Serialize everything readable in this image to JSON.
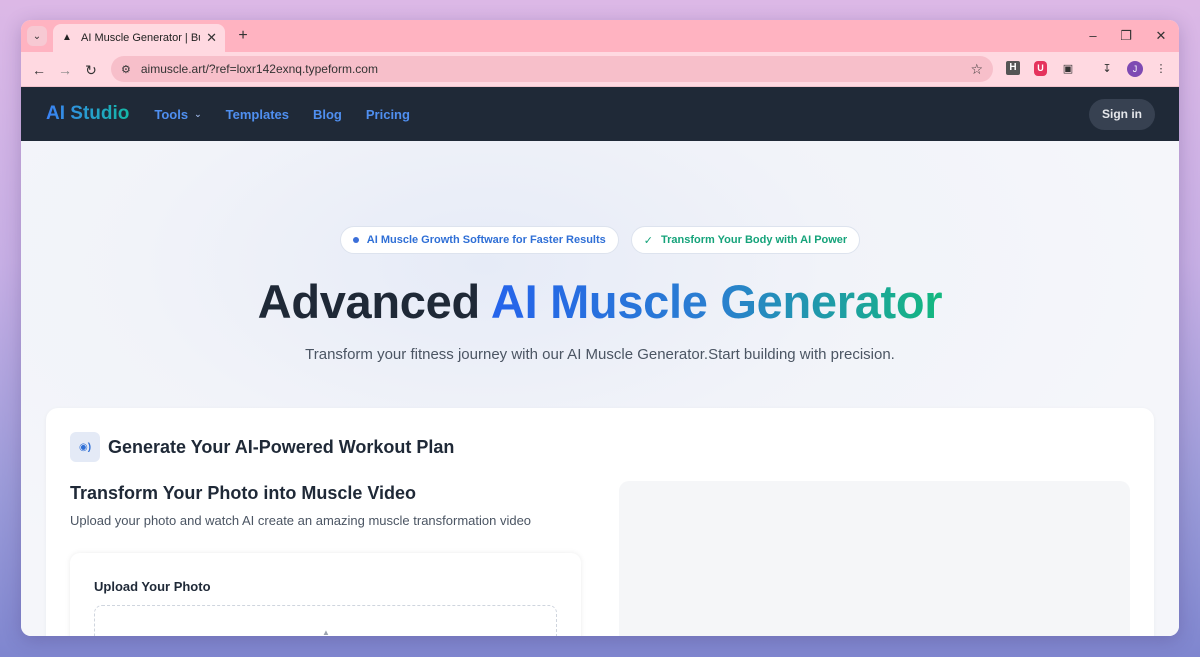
{
  "browser": {
    "tab_title": "AI Muscle Generator | Build Mu",
    "favicon": "a-logo-icon",
    "url": "aimuscle.art/?ref=loxr142exnq.typeform.com",
    "ext_h": "H",
    "ext_shield": "U",
    "avatar_letter": "J"
  },
  "nav": {
    "logo": "AI Studio",
    "links": [
      "Tools",
      "Templates",
      "Blog",
      "Pricing"
    ],
    "sign_in": "Sign in"
  },
  "hero": {
    "pill_1": "AI Muscle Growth Software for Faster Results",
    "pill_2": "Transform Your Body with AI Power",
    "title_plain": "Advanced ",
    "title_gradient": "AI Muscle Generator",
    "subtitle": "Transform your fitness journey with our AI Muscle Generator.Start building with precision."
  },
  "card": {
    "header": "Generate Your AI-Powered Workout Plan",
    "section_title": "Transform Your Photo into Muscle Video",
    "section_desc": "Upload your photo and watch AI create an amazing muscle transformation video",
    "upload_label": "Upload Your Photo"
  },
  "colors": {
    "tab_strip": "#ffb3c1",
    "nav_bg": "#1f2937",
    "accent_blue": "#2563eb",
    "accent_green": "#14b87f"
  }
}
